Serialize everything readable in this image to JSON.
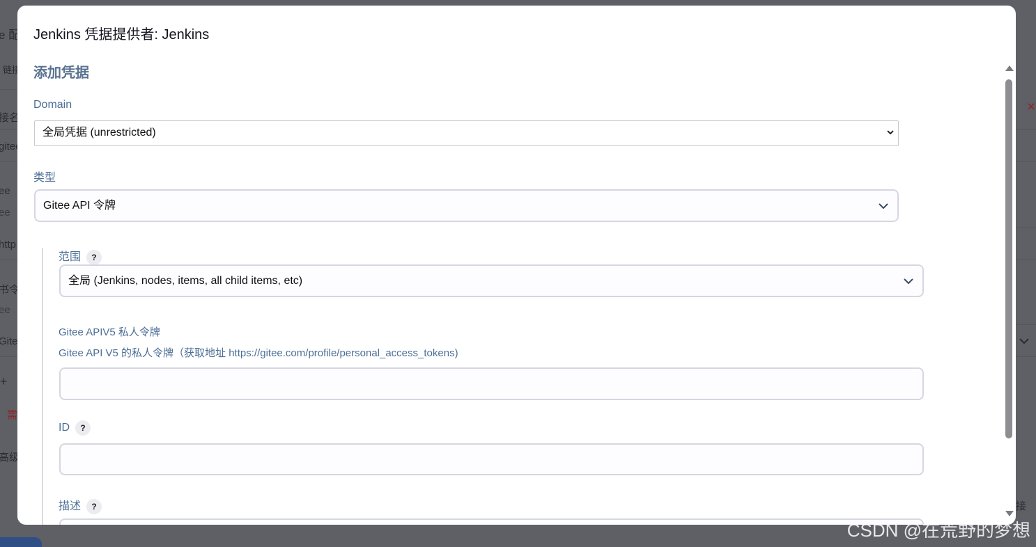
{
  "background": {
    "fragments": [
      "e 配",
      "链接",
      "接名",
      "gitee",
      "ee",
      "ee",
      "http",
      "书令",
      "ee",
      "Gitee",
      "+",
      "需",
      "高级",
      "接"
    ],
    "close_icon": "close-icon"
  },
  "dialog": {
    "title": "Jenkins 凭据提供者: Jenkins",
    "section_title": "添加凭据",
    "domain": {
      "label": "Domain",
      "value": "全局凭据 (unrestricted)"
    },
    "kind": {
      "label": "类型",
      "value": "Gitee API 令牌"
    },
    "scope": {
      "label": "范围",
      "help": "?",
      "value": "全局 (Jenkins, nodes, items, all child items, etc)"
    },
    "token": {
      "label": "Gitee APIV5 私人令牌",
      "description": "Gitee API V5 的私人令牌（获取地址 https://gitee.com/profile/personal_access_tokens)",
      "value": ""
    },
    "id": {
      "label": "ID",
      "help": "?",
      "value": ""
    },
    "description_field": {
      "label": "描述",
      "help": "?",
      "value": ""
    }
  },
  "watermark": "CSDN @在荒野的梦想",
  "colors": {
    "overlay": "#5f5f66",
    "label": "#4b6e96",
    "section_title": "#5a7390",
    "input_border": "#d6d6e2"
  }
}
